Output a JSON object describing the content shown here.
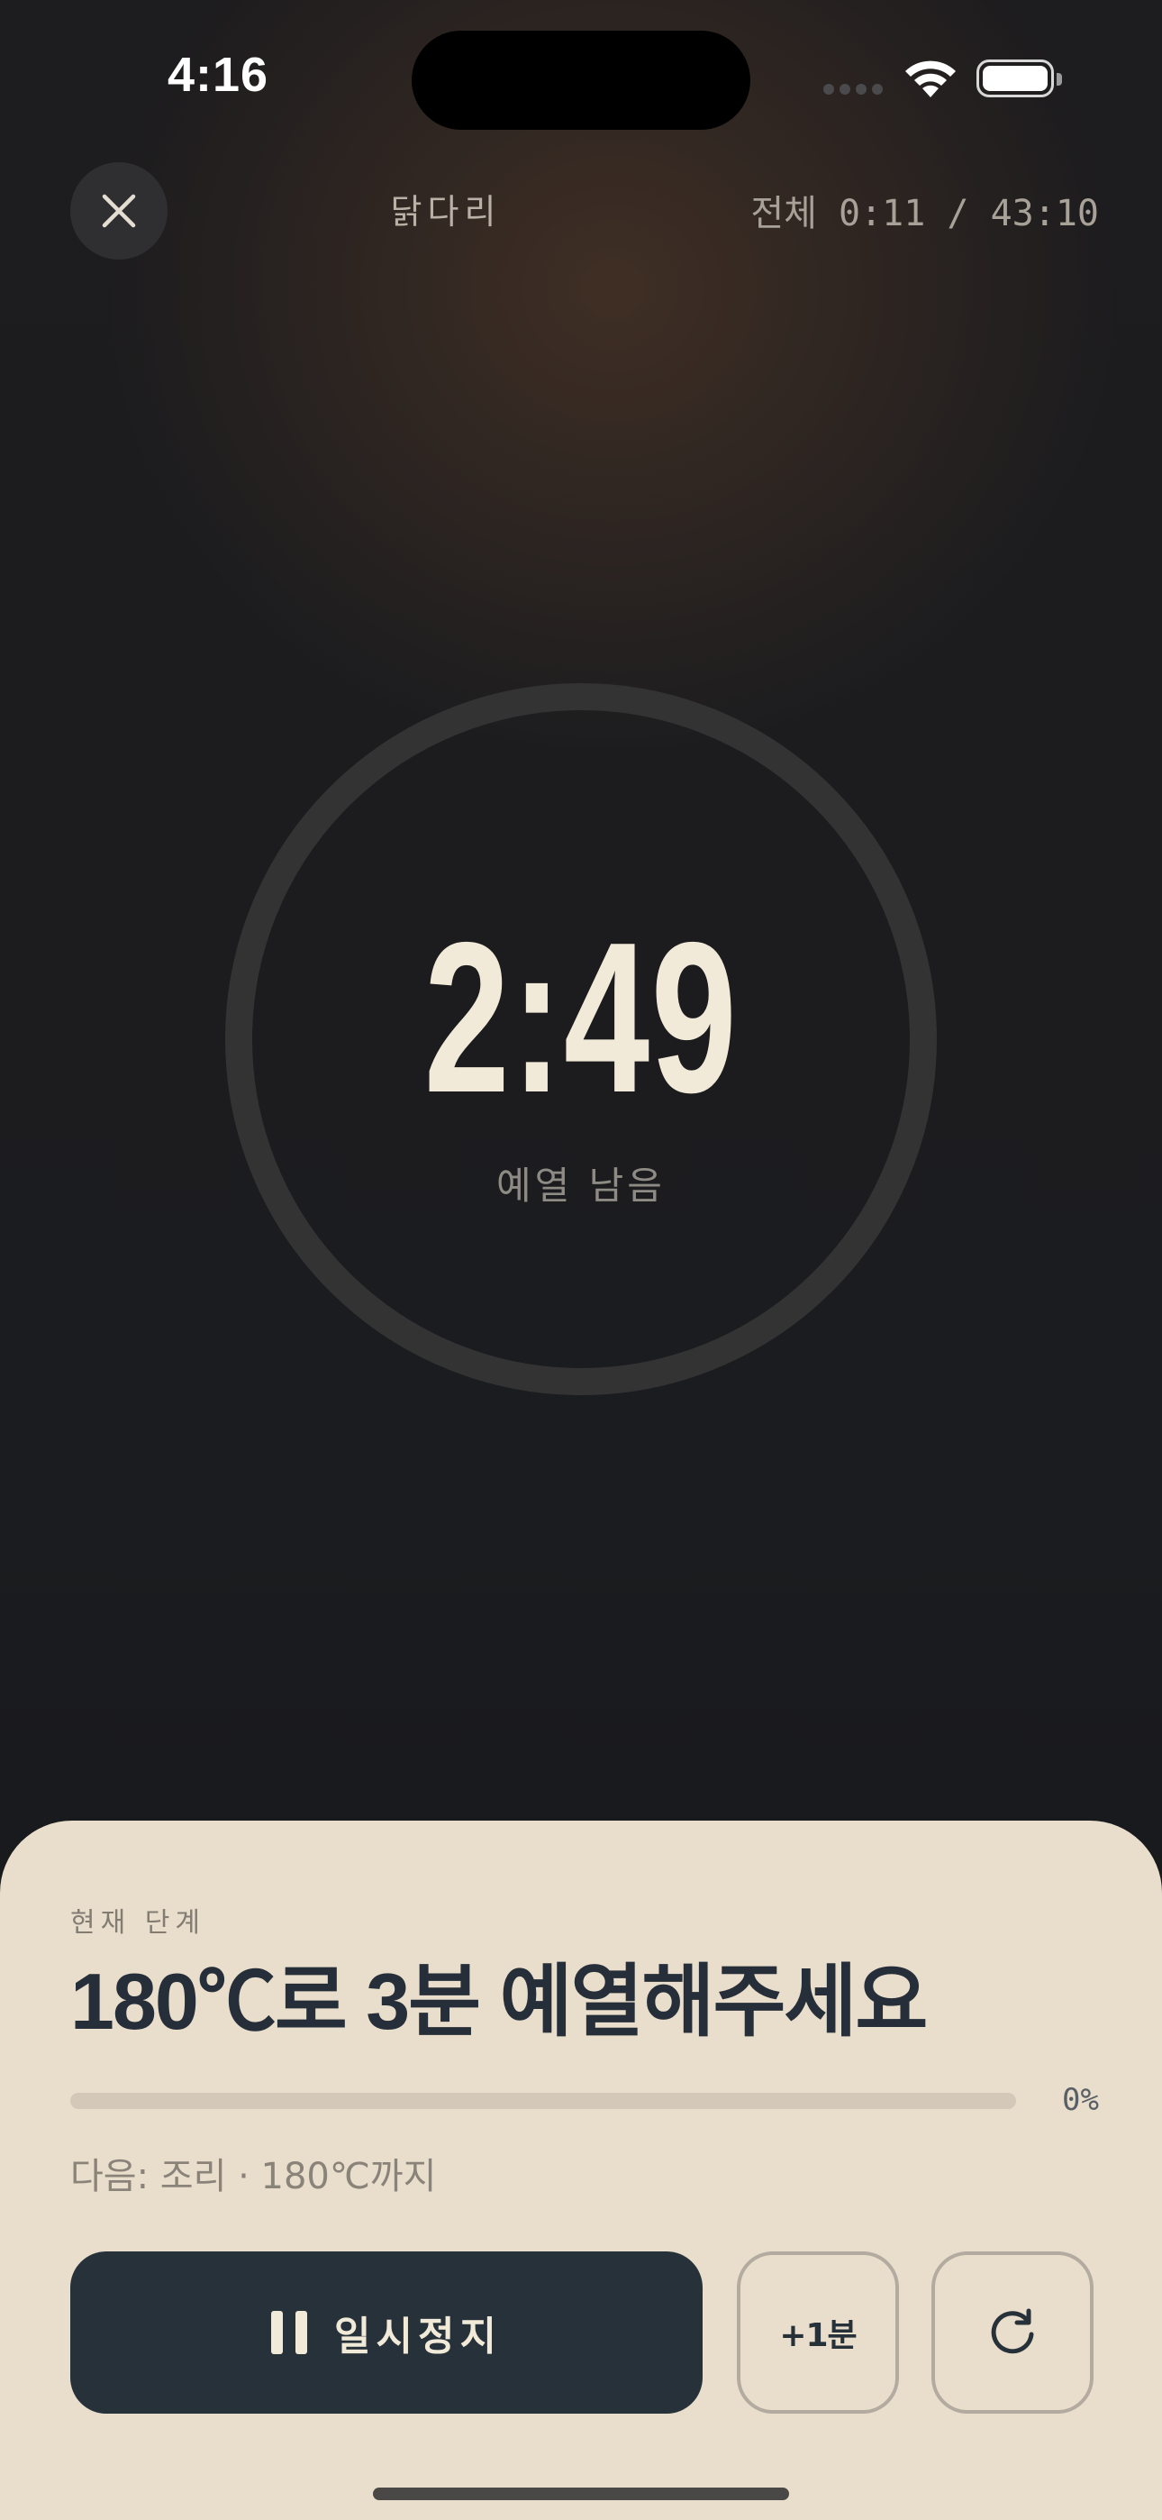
{
  "status_bar": {
    "time": "4:16"
  },
  "header": {
    "recipe_name": "닭다리",
    "total_label": "전체 0:11 / 43:10"
  },
  "timer": {
    "value": "2:49",
    "label": "예열 남음",
    "ring_progress_fraction": 0
  },
  "sheet": {
    "caption": "현재 단계",
    "step_title": "180℃로 3분 예열해주세요",
    "progress_percent": 0,
    "progress_label": "0%",
    "next_step": "다음: 조리 · 180℃까지",
    "pause_label": "일시정지",
    "add_minute_label": "+1분"
  },
  "colors": {
    "background": "#1b1c1f",
    "sheet": "#e9ddcb",
    "primary_button": "#27313a",
    "timer_text": "#f2ead9"
  },
  "icons": [
    "close-icon",
    "pause-icon",
    "restart-icon",
    "wifi-icon",
    "battery-icon",
    "cellular-signal-icon"
  ]
}
